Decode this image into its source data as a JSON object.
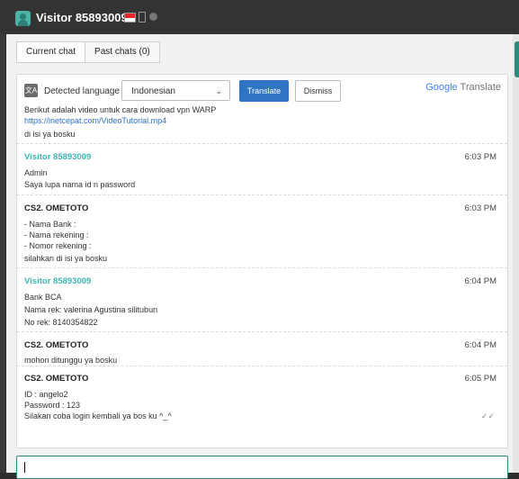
{
  "header": {
    "title": "Visitor 85893009"
  },
  "tabs": [
    {
      "label": "Current chat"
    },
    {
      "label": "Past chats (0)"
    }
  ],
  "translate": {
    "detected_label": "Detected language",
    "selected_language": "Indonesian",
    "translate_button": "Translate",
    "dismiss_button": "Dismiss",
    "brand_google": "Google",
    "brand_translate": "Translate"
  },
  "first_message": {
    "lines": [
      "Berikut adalah video untuk cara download vpn WARP",
      "https://inetcepat.com/VideoTutorial.mp4",
      "di isi ya bosku"
    ]
  },
  "messages": [
    {
      "sender": "Visitor 85893009",
      "type": "visitor",
      "time": "6:03 PM",
      "lines": [
        "Admin",
        "Saya lupa nama id n password"
      ]
    },
    {
      "sender": "CS2. OMETOTO",
      "type": "agent",
      "time": "6:03 PM",
      "lines": [
        "- Nama Bank :",
        "- Nama rekening :",
        "- Nomor rekening :",
        "silahkan di isi ya bosku"
      ]
    },
    {
      "sender": "Visitor 85893009",
      "type": "visitor",
      "time": "6:04 PM",
      "lines": [
        "Bank BCA",
        "Nama rek: valerina Agustina silitubun",
        "No rek: 8140354822"
      ]
    },
    {
      "sender": "CS2. OMETOTO",
      "type": "agent",
      "time": "6:04 PM",
      "lines": [
        "mohon ditunggu ya bosku"
      ]
    },
    {
      "sender": "CS2. OMETOTO",
      "type": "agent",
      "time": "6:05 PM",
      "lines": [
        "ID : angelo2",
        "Password : 123",
        "Silakan coba login kembali ya bos ku ^_^"
      ]
    }
  ]
}
